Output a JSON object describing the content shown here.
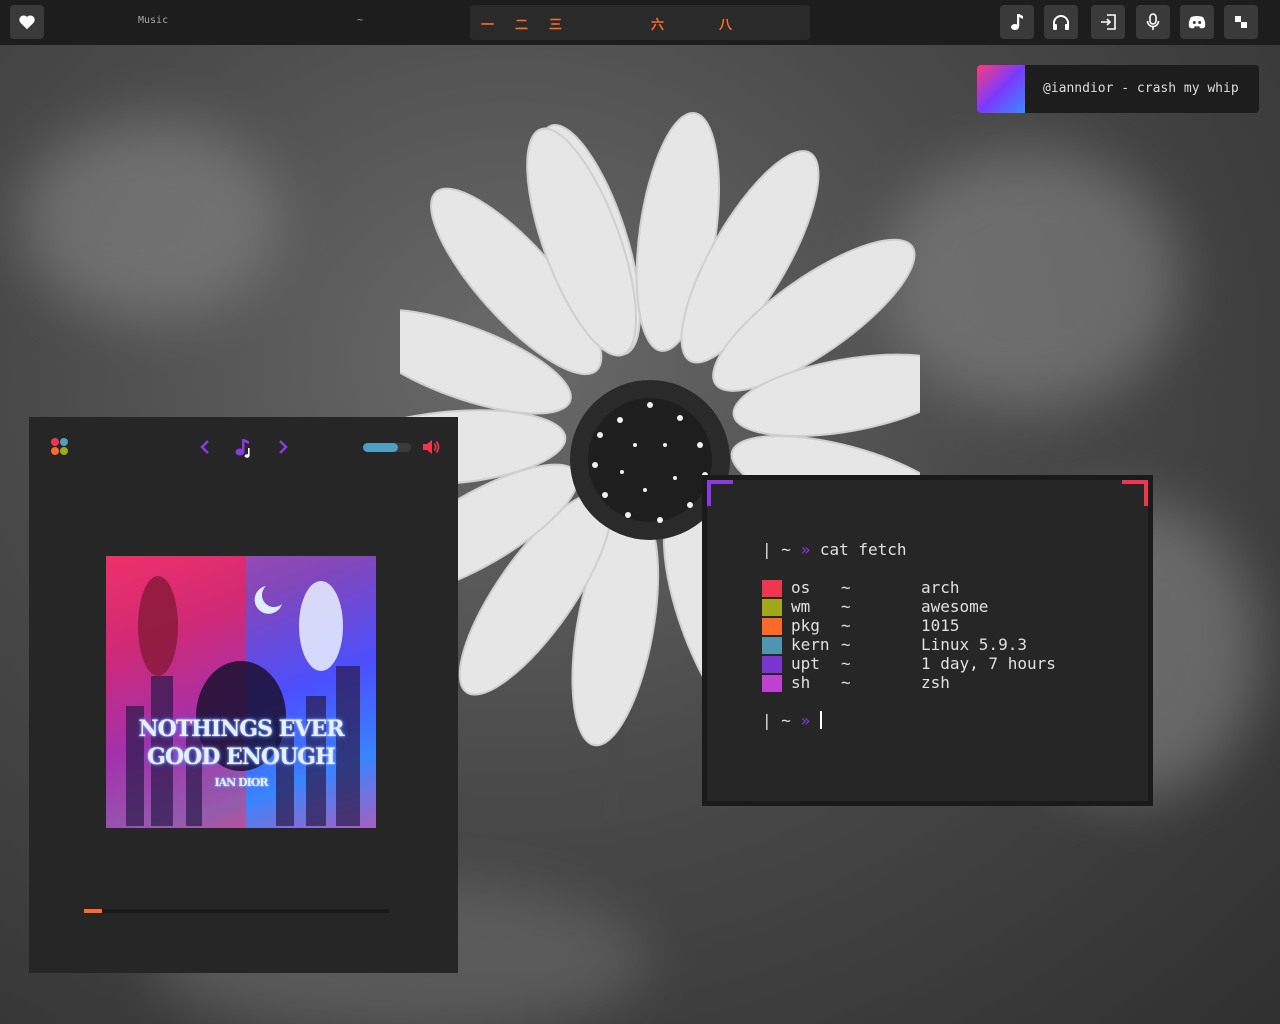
{
  "topbar": {
    "music_label": "Music",
    "tilde_label": "~",
    "tags": [
      "一",
      "二",
      "三",
      "六",
      "八"
    ],
    "right_icons": [
      "music-note-icon",
      "headphones-icon",
      "login-icon",
      "microphone-icon",
      "discord-icon",
      "layout-icon"
    ]
  },
  "notification": {
    "text": "@ianndior - crash my whip"
  },
  "player": {
    "album_title_line1": "NOTHINGS EVER",
    "album_title_line2": "GOOD ENOUGH",
    "album_artist": "IAN DIOR",
    "volume_level": 0.72,
    "progress": 0.06
  },
  "terminal": {
    "prompt_pipe": "|",
    "prompt_tilde": "~",
    "prompt_arrow": "»",
    "command": "cat fetch",
    "fetch": [
      {
        "key": "os",
        "sep": "~",
        "value": "arch",
        "color": "#f0354f"
      },
      {
        "key": "wm",
        "sep": "~",
        "value": "awesome",
        "color": "#a0a818"
      },
      {
        "key": "pkg",
        "sep": "~",
        "value": "1015",
        "color": "#ff6a2a"
      },
      {
        "key": "kern",
        "sep": "~",
        "value": "Linux 5.9.3",
        "color": "#4f94b0"
      },
      {
        "key": "upt",
        "sep": "~",
        "value": "1 day, 7 hours",
        "color": "#7a35d0"
      },
      {
        "key": "sh",
        "sep": "~",
        "value": "zsh",
        "color": "#c040d0"
      }
    ]
  },
  "colors": {
    "accent_orange": "#ff6a2a",
    "accent_purple": "#8a3ae0",
    "accent_pink": "#f0354f",
    "accent_blue": "#4fa0c0"
  }
}
